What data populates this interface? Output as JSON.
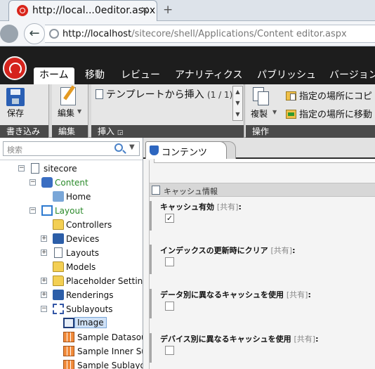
{
  "browser": {
    "tab_title": "http://local...0editor.aspx",
    "tab_close": "✕",
    "new_tab": "+",
    "url_host": "http://localhost",
    "url_path": "/sitecore/shell/Applications/Content editor.aspx",
    "back_arrow": "←"
  },
  "ribbon_tabs": [
    "ホーム",
    "移動",
    "レビュー",
    "アナリティクス",
    "パブリッシュ",
    "バージョン"
  ],
  "ribbon": {
    "write_group": {
      "button": "保存",
      "label": "書き込み"
    },
    "edit_group": {
      "button": "編集",
      "label": "編集"
    },
    "insert_group": {
      "item": "テンプレートから挿入",
      "count": "(1 / 1)",
      "label": "挿入"
    },
    "ops_group": {
      "duplicate": "複製",
      "copy_to": "指定の場所にコピ",
      "move_to": "指定の場所に移動",
      "label": "操作"
    }
  },
  "tree": {
    "search_placeholder": "検索",
    "nodes": [
      {
        "label": "sitecore",
        "toggle": "−",
        "icon": "page"
      },
      {
        "label": "Content",
        "toggle": "−",
        "icon": "content"
      },
      {
        "label": "Home",
        "toggle": "",
        "icon": "home"
      },
      {
        "label": "Layout",
        "toggle": "−",
        "icon": "layout"
      },
      {
        "label": "Controllers",
        "toggle": "",
        "icon": "folder"
      },
      {
        "label": "Devices",
        "toggle": "+",
        "icon": "blue"
      },
      {
        "label": "Layouts",
        "toggle": "+",
        "icon": "page"
      },
      {
        "label": "Models",
        "toggle": "",
        "icon": "folder"
      },
      {
        "label": "Placeholder Settings",
        "toggle": "+",
        "icon": "folder"
      },
      {
        "label": "Renderings",
        "toggle": "+",
        "icon": "blue"
      },
      {
        "label": "Sublayouts",
        "toggle": "−",
        "icon": "sub"
      },
      {
        "label": "Image",
        "toggle": "",
        "icon": "img"
      },
      {
        "label": "Sample Datasource",
        "toggle": "",
        "icon": "grid"
      },
      {
        "label": "Sample Inner Sub",
        "toggle": "",
        "icon": "grid"
      },
      {
        "label": "Sample Sublayout",
        "toggle": "",
        "icon": "grid"
      }
    ]
  },
  "editor": {
    "tab_label": "コンテンツ",
    "section_title": "キャッシュ情報",
    "shared_label": "[共有]",
    "fields": [
      {
        "label": "キャッシュ有効",
        "checked": true
      },
      {
        "label": "インデックスの更新時にクリア",
        "checked": false
      },
      {
        "label": "データ別に異なるキャッシュを使用",
        "checked": false
      },
      {
        "label": "デバイス別に異なるキャッシュを使用",
        "checked": false
      }
    ]
  },
  "colors": {
    "content_green": "#2a8a2a",
    "ribbon_dark": "#1d1d1d",
    "sitecore_red": "#d5231c"
  }
}
